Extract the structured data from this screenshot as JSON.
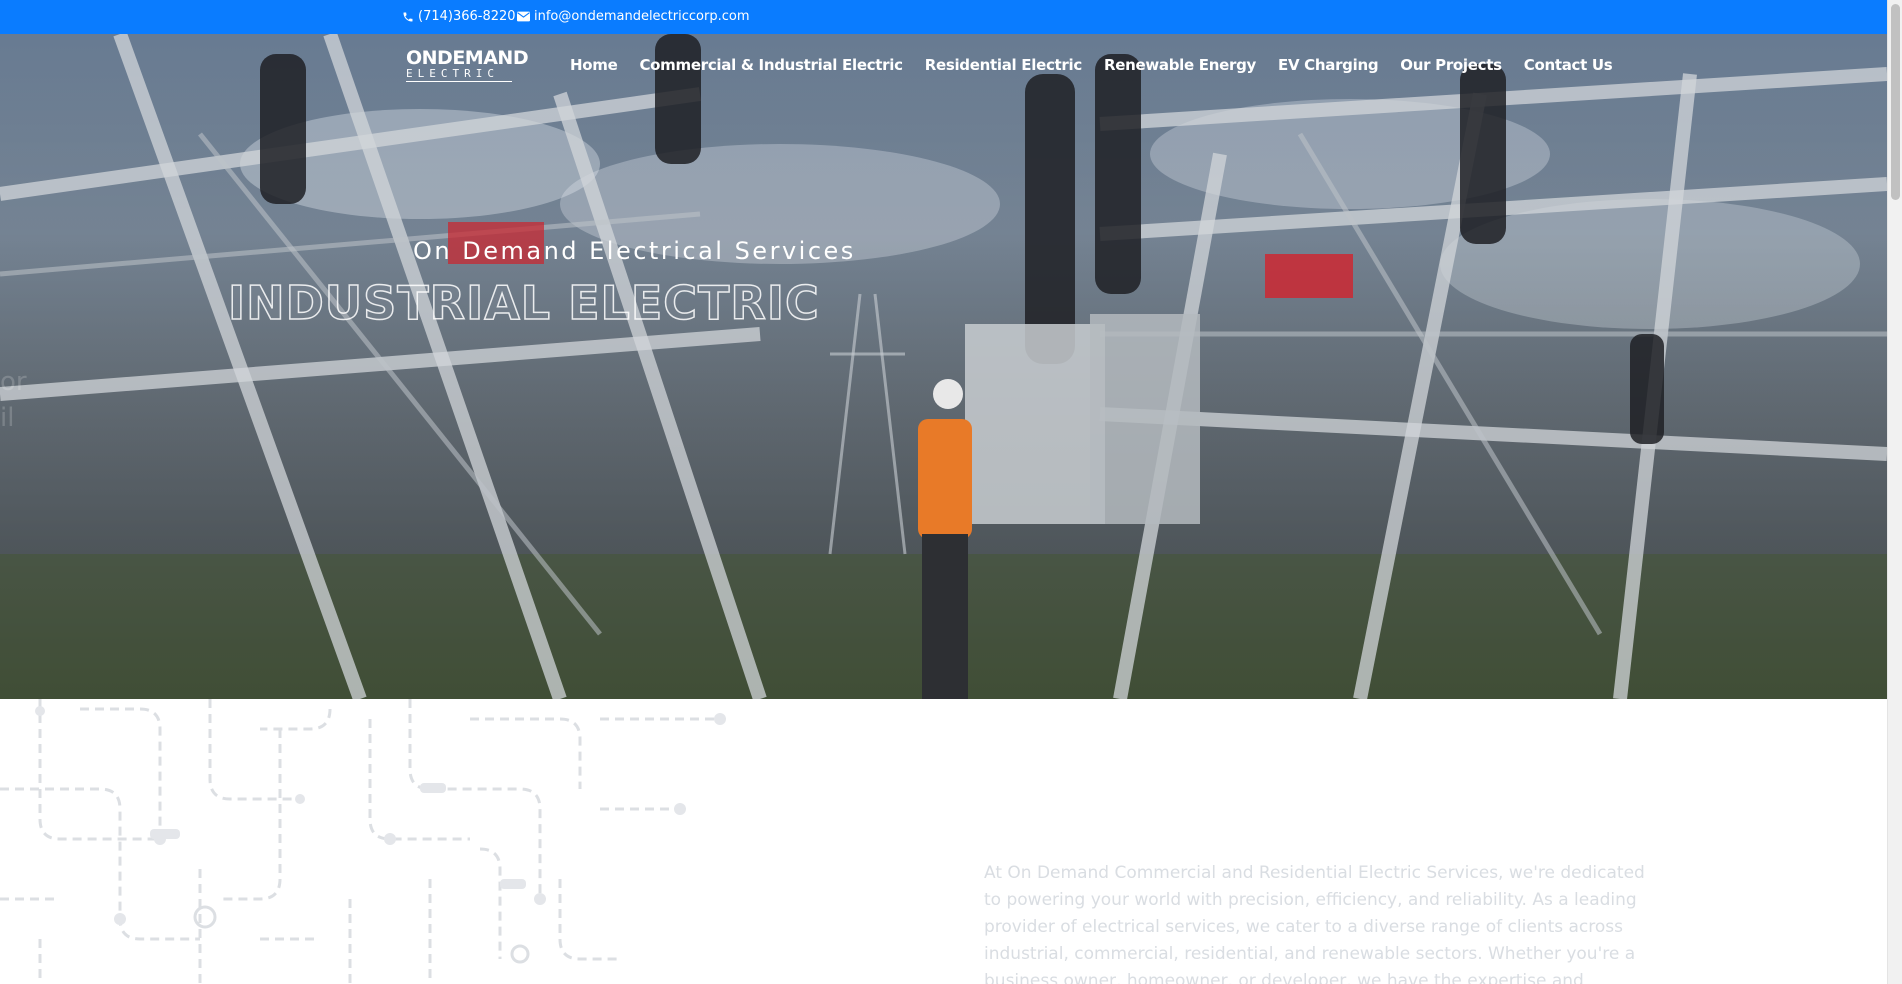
{
  "topbar": {
    "phone": "(714)366-8220",
    "email": "info@ondemandelectriccorp.com",
    "background": "#0a7cff",
    "icons": [
      "phone-icon",
      "email-icon"
    ]
  },
  "logo": {
    "line1": "ONDEMAND",
    "line2": "ELECTRIC"
  },
  "nav": {
    "items": [
      "Home",
      "Commercial & Industrial Electric",
      "Residential Electric",
      "Renewable Energy",
      "EV Charging",
      "Our Projects",
      "Contact Us"
    ]
  },
  "hero": {
    "subtitle": "On Demand Electrical Services",
    "title": "INDUSTRIAL ELECTRIC"
  },
  "intro": {
    "text": "At On Demand Commercial and Residential Electric Services, we're dedicated to powering your world with precision, efficiency, and reliability. As a leading provider of electrical services, we cater to a diverse range of clients across industrial, commercial, residential, and renewable sectors. Whether you're a business owner, homeowner, or developer, we have the expertise and experience to meet your"
  }
}
